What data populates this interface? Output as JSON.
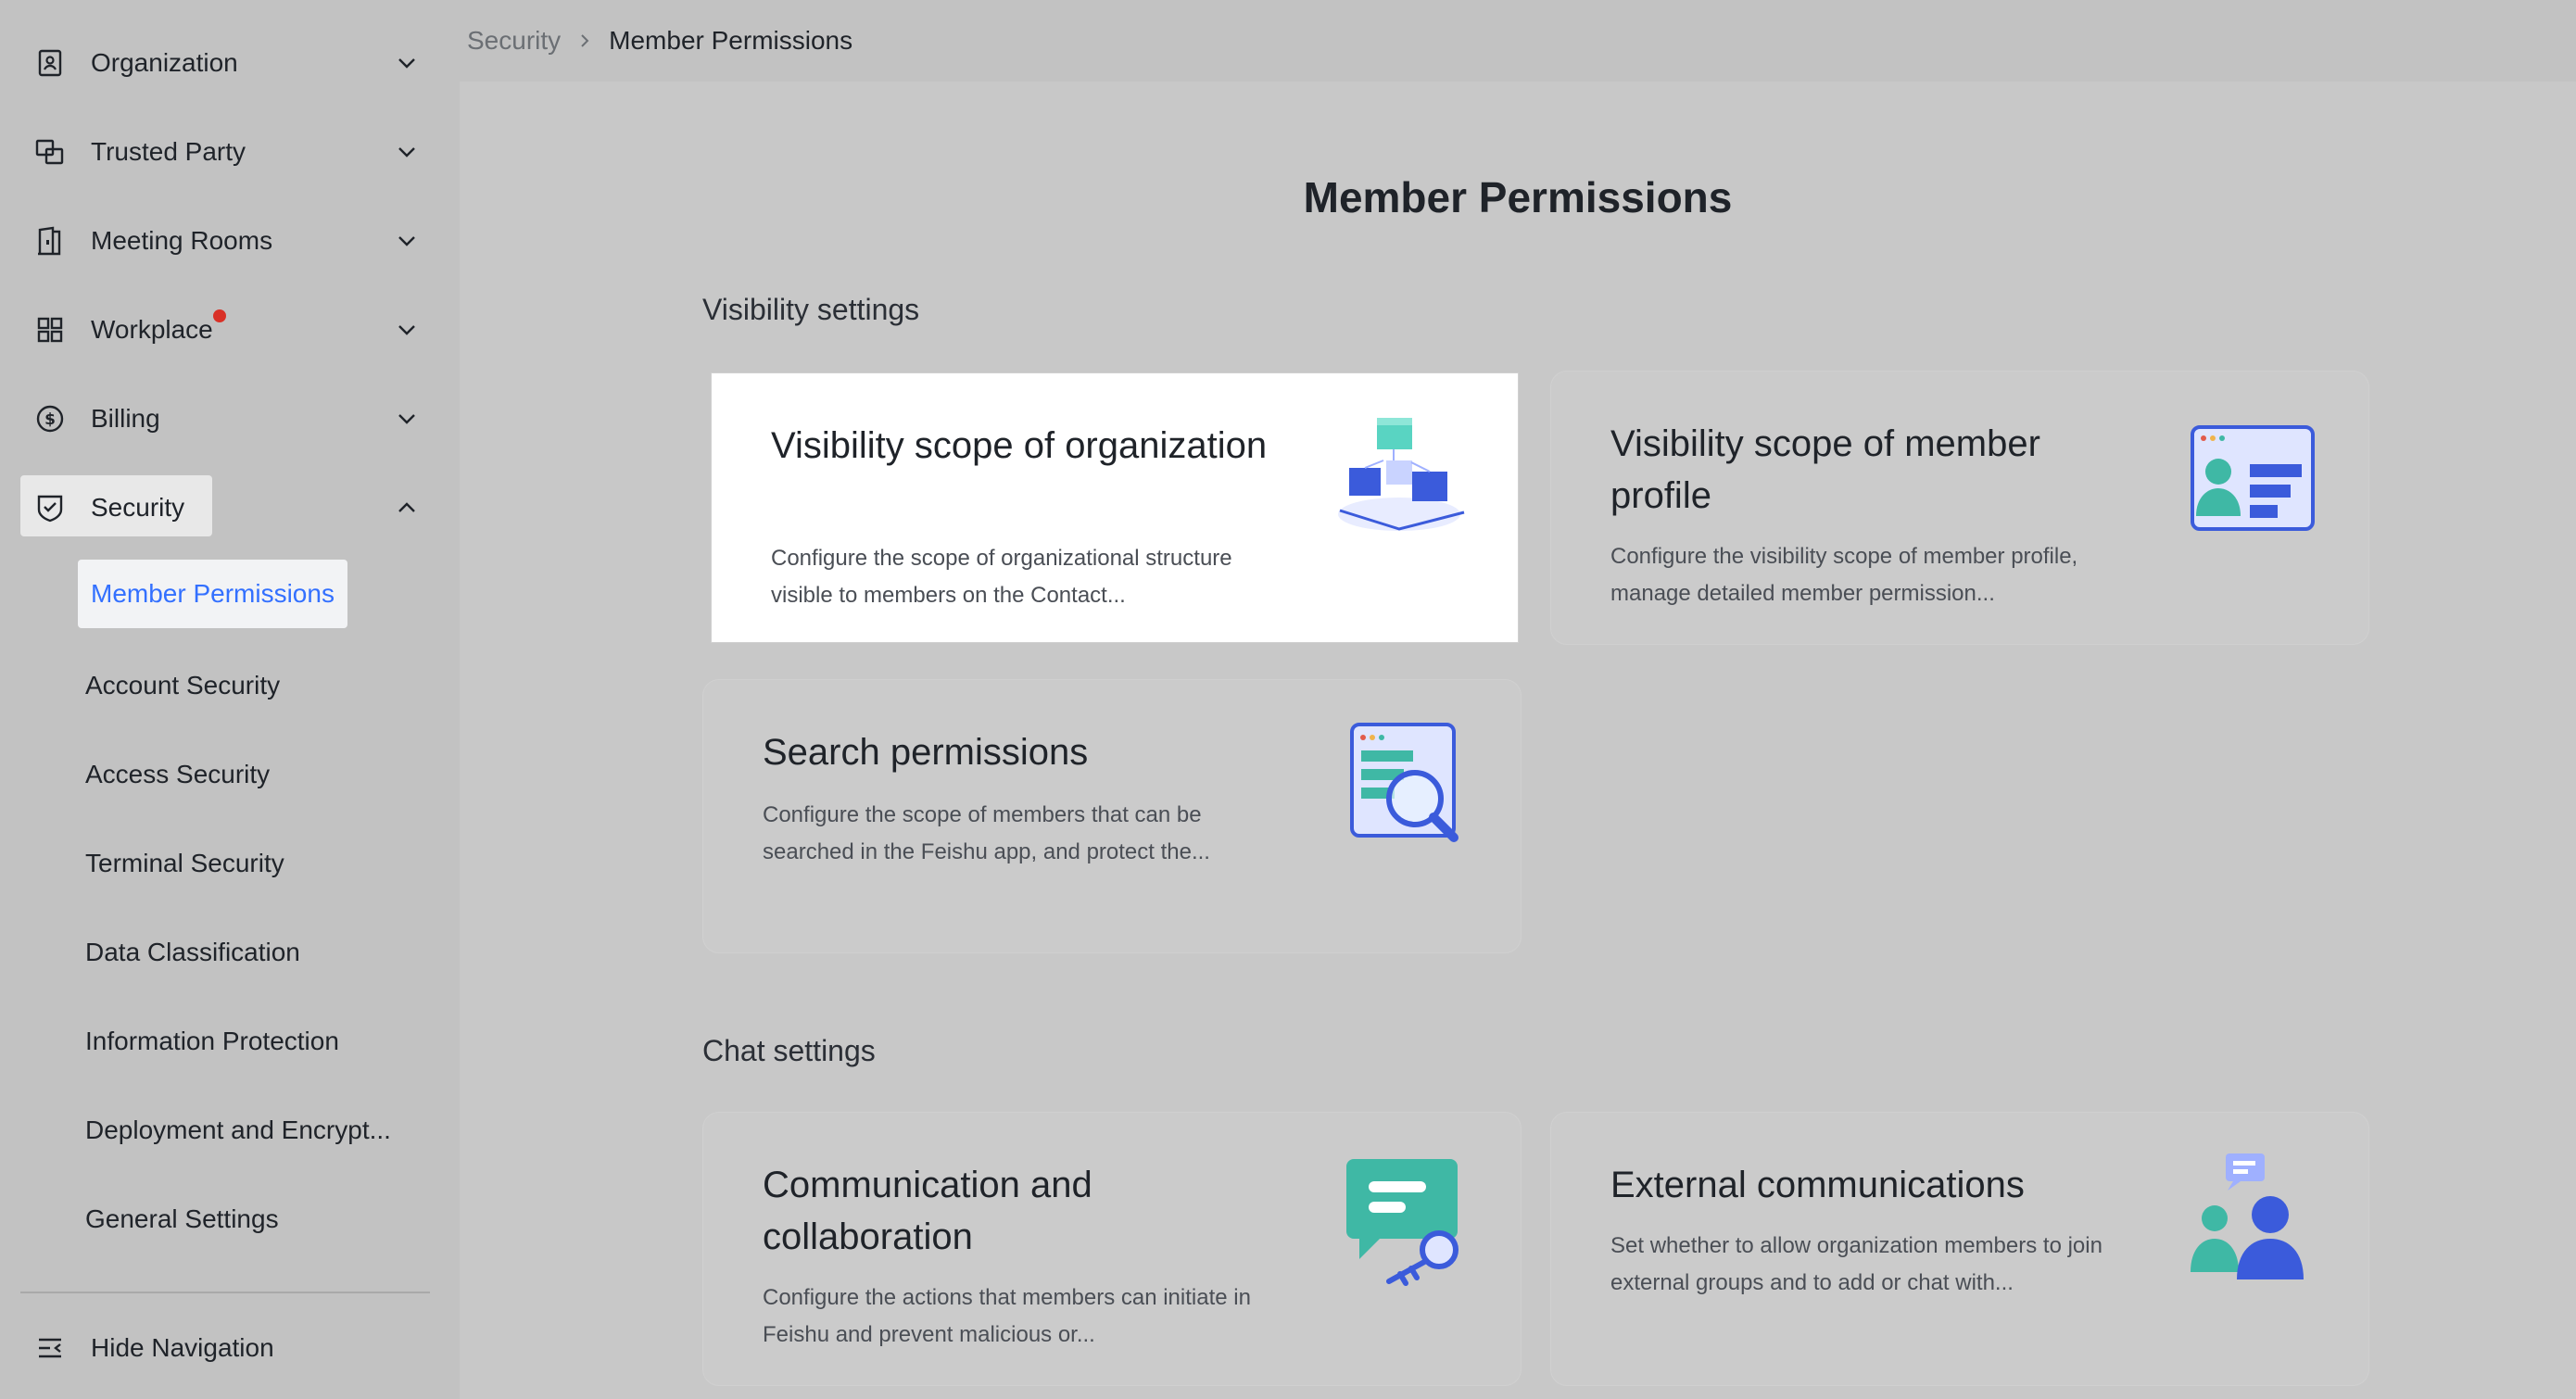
{
  "sidebar": {
    "items": [
      {
        "label": "Organization",
        "icon": "contact-book-icon"
      },
      {
        "label": "Trusted Party",
        "icon": "linked-squares-icon"
      },
      {
        "label": "Meeting Rooms",
        "icon": "door-icon"
      },
      {
        "label": "Workplace",
        "icon": "grid-icon"
      },
      {
        "label": "Billing",
        "icon": "dollar-circle-icon"
      },
      {
        "label": "Security",
        "icon": "shield-check-icon"
      }
    ],
    "security_subitems": [
      "Member Permissions",
      "Account Security",
      "Access Security",
      "Terminal Security",
      "Data Classification",
      "Information Protection",
      "Deployment and Encrypt...",
      "General Settings"
    ],
    "hide_navigation": "Hide Navigation"
  },
  "breadcrumb": {
    "parent": "Security",
    "current": "Member Permissions"
  },
  "main": {
    "title": "Member Permissions",
    "visibility_section": "Visibility settings",
    "chat_section": "Chat settings",
    "cards": {
      "org_scope": {
        "title": "Visibility scope of organization",
        "desc": "Configure the scope of organizational structure visible to members on the Contact..."
      },
      "member_profile": {
        "title": "Visibility scope of member profile",
        "desc": "Configure the visibility scope of member profile, manage detailed member permission..."
      },
      "search": {
        "title": "Search permissions",
        "desc": "Configure the scope of members that can be searched in the Feishu app, and protect the..."
      },
      "communication": {
        "title": "Communication and collaboration",
        "desc": "Configure the actions that members can initiate in Feishu and prevent malicious or..."
      },
      "external": {
        "title": "External communications",
        "desc": "Set whether to allow organization members to join external groups and to add or chat with..."
      }
    }
  },
  "colors": {
    "accent": "#3370ff",
    "notification": "#d93026",
    "teal": "#3fb8a5",
    "blue": "#3b5bdb"
  }
}
